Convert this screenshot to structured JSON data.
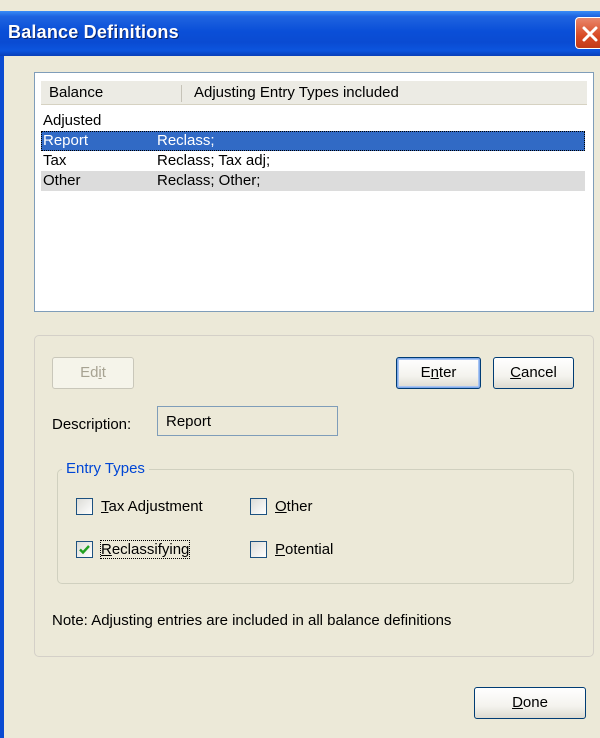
{
  "window": {
    "title": "Balance Definitions"
  },
  "list": {
    "columns": [
      "Balance",
      "Adjusting Entry Types included"
    ],
    "rows": [
      {
        "balance": "Adjusted",
        "types": ""
      },
      {
        "balance": "Report",
        "types": "Reclass;",
        "selected": true
      },
      {
        "balance": "Tax",
        "types": "Reclass; Tax adj;"
      },
      {
        "balance": "Other",
        "types": "Reclass; Other;"
      }
    ]
  },
  "buttons": {
    "edit": {
      "pre": "Ed",
      "acc": "i",
      "post": "t"
    },
    "enter": {
      "pre": "E",
      "acc": "n",
      "post": "ter"
    },
    "cancel": {
      "pre": "",
      "acc": "C",
      "post": "ancel"
    },
    "done": {
      "pre": "",
      "acc": "D",
      "post": "one"
    }
  },
  "description": {
    "label": "Description:",
    "value": "Report"
  },
  "entry_types": {
    "legend": "Entry Types",
    "tax_adjustment": {
      "pre": "",
      "acc": "T",
      "post": "ax Adjustment",
      "checked": false
    },
    "other": {
      "pre": "",
      "acc": "O",
      "post": "ther",
      "checked": false
    },
    "reclassifying": {
      "pre": "",
      "acc": "R",
      "post": "eclassifying",
      "checked": true
    },
    "potential": {
      "pre": "",
      "acc": "P",
      "post": "otential",
      "checked": false
    }
  },
  "note": "Note: Adjusting entries are included in all balance definitions",
  "colors": {
    "title_blue": "#0a4fd8",
    "selection": "#316ac5",
    "legend_blue": "#0046d5",
    "check_green": "#21a121"
  }
}
